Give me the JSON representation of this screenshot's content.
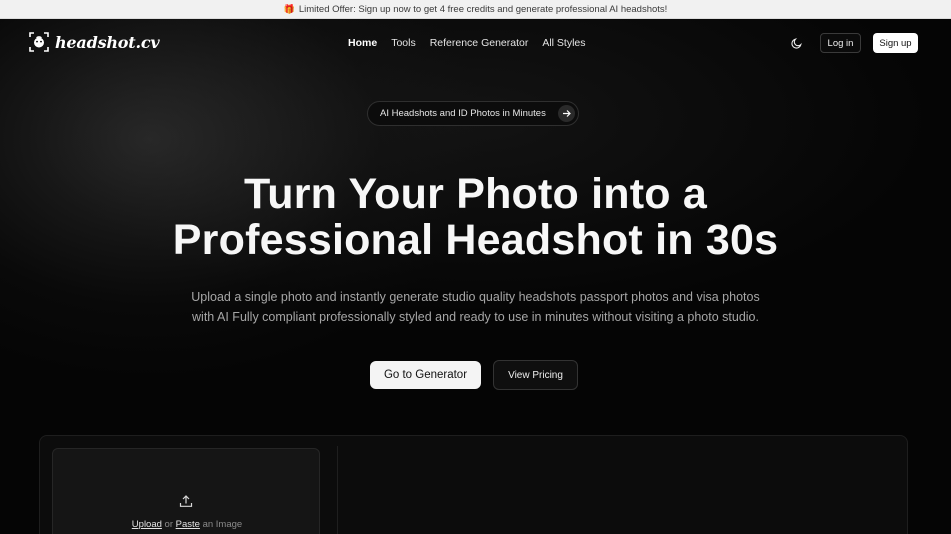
{
  "banner": {
    "icon": "gift-icon",
    "text": "Limited Offer: Sign up now to get 4 free credits and generate professional AI headshots!"
  },
  "nav": {
    "logo_text": "headshot.cv",
    "logo_icon": "face-scan-icon",
    "links": [
      {
        "label": "Home",
        "active": true
      },
      {
        "label": "Tools",
        "active": false
      },
      {
        "label": "Reference Generator",
        "active": false
      },
      {
        "label": "All Styles",
        "active": false
      }
    ],
    "theme_icon": "moon-icon",
    "login_label": "Log in",
    "signup_label": "Sign up"
  },
  "hero": {
    "pill_text": "AI Headshots and ID Photos in Minutes",
    "pill_icon": "arrow-right-icon",
    "headline_line1": "Turn Your Photo into a",
    "headline_line2": "Professional Headshot in 30s",
    "sub_line1": "Upload a single photo and instantly generate studio quality headshots passport photos and visa photos",
    "sub_line2": "with AI Fully compliant professionally styled and ready to use in minutes without visiting a photo studio.",
    "primary_cta": "Go to Generator",
    "secondary_cta": "View Pricing"
  },
  "uploader": {
    "icon": "upload-icon",
    "upload_link": "Upload",
    "or_text": " or ",
    "paste_link": "Paste",
    "suffix_text": " an Image"
  },
  "colors": {
    "background": "#050505",
    "banner_bg": "#f1f1f1",
    "primary_button": "#f4f4f4"
  }
}
